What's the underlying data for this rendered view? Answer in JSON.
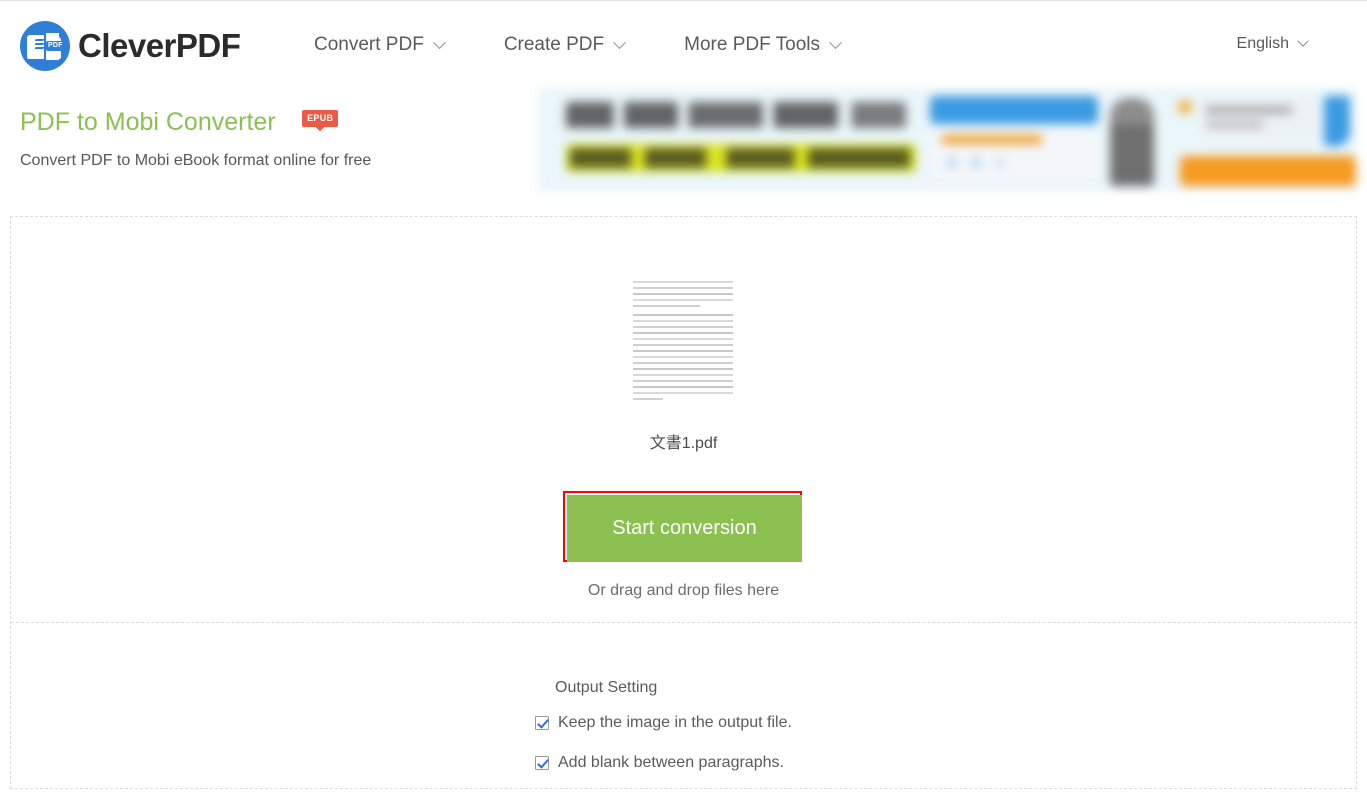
{
  "header": {
    "brand": "CleverPDF",
    "logo_icon": "cleverpdf-logo-icon",
    "nav": [
      {
        "label": "Convert PDF",
        "icon": "chevron-down-icon"
      },
      {
        "label": "Create PDF",
        "icon": "chevron-down-icon"
      },
      {
        "label": "More PDF Tools",
        "icon": "chevron-down-icon"
      }
    ],
    "language": {
      "label": "English",
      "icon": "chevron-down-icon"
    }
  },
  "page": {
    "title": "PDF to Mobi Converter",
    "badge": "EPUB",
    "subtitle": "Convert PDF to Mobi eBook format online for free"
  },
  "banner": {
    "name": "advertisement-banner",
    "background": "#eaf6fb",
    "highlight": "#dbe520",
    "accent_blue": "#3b9ae1",
    "accent_orange": "#f59b22"
  },
  "upload": {
    "file_name": "文書1.pdf",
    "thumbnail_icon": "document-preview-icon",
    "start_button": "Start conversion",
    "button_color": "#8cc152",
    "highlight_border": "#ff0000",
    "drag_hint": "Or drag and drop files here"
  },
  "output_setting": {
    "title": "Output Setting",
    "options": [
      {
        "label": "Keep the image in the output file.",
        "checked": true
      },
      {
        "label": "Add blank between paragraphs.",
        "checked": true
      }
    ]
  }
}
